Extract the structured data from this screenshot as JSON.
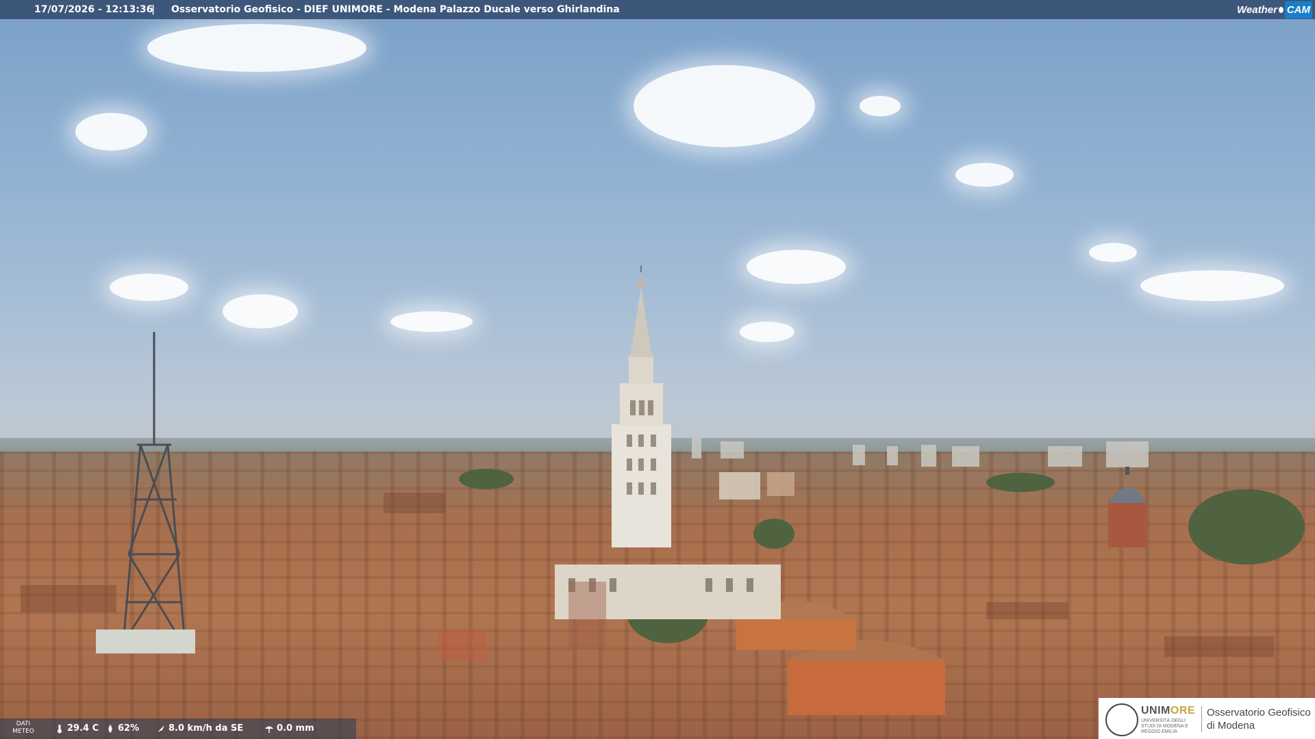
{
  "overlay": {
    "timestamp": "17/07/2026 - 12:13:36",
    "separator": "|",
    "title": "Osservatorio Geofisico - DIEF UNIMORE - Modena Palazzo Ducale verso Ghirlandina"
  },
  "brand": {
    "weather_text": "Weather",
    "cam_text": "CAM",
    "accent_color": "#1a7fc9"
  },
  "meteo": {
    "label_line1": "DATI",
    "label_line2": "METEO",
    "temperature": "29.4 C",
    "humidity": "62%",
    "wind": "8.0 km/h da SE",
    "rain": "0.0 mm",
    "icons": [
      "thermometer-icon",
      "humidity-drop-icon",
      "wind-vane-icon",
      "rain-gauge-icon"
    ]
  },
  "university": {
    "name_main": "UNIM",
    "name_accent": "ORE",
    "name_sub": "UNIVERSITÀ DEGLI STUDI DI MODENA E REGGIO EMILIA",
    "observatory_line1": "Osservatorio Geofisico",
    "observatory_line2": "di Modena"
  },
  "colors": {
    "sky": "#8fb0d2",
    "roofs": "#b07652",
    "tower": "#e8e4dc",
    "topbar": "#37506f"
  }
}
